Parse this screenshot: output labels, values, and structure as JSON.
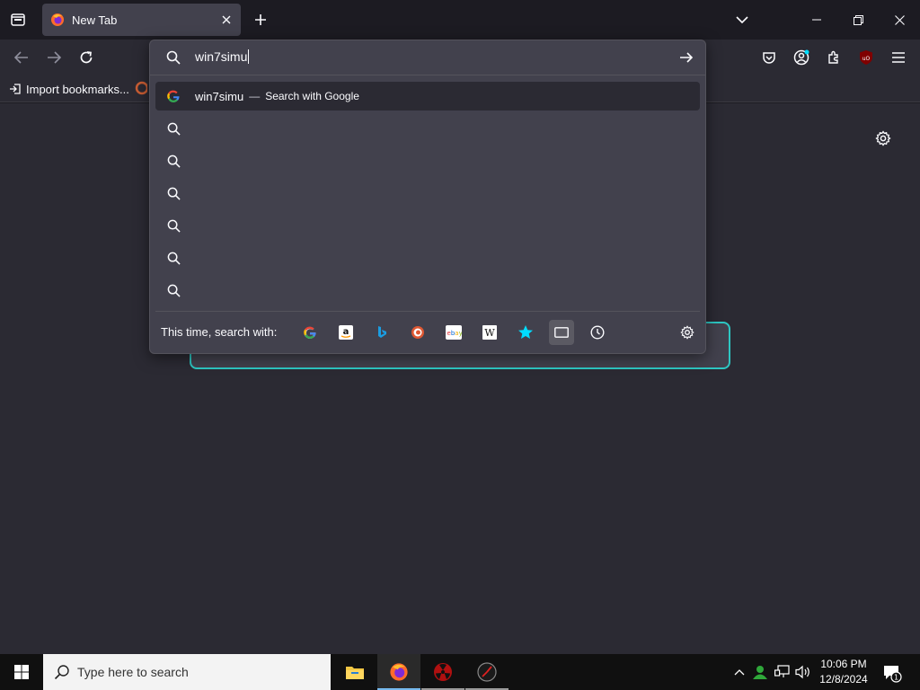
{
  "browser": {
    "tab_title": "New Tab",
    "bookmarks_import_label": "Import bookmarks..."
  },
  "urlbar": {
    "value": "win7simu",
    "suggestions": [
      {
        "text": "win7simu",
        "sub": "Search with Google",
        "icon": "google-icon",
        "selected": true
      },
      {
        "text": "",
        "icon": "search-icon"
      },
      {
        "text": "",
        "icon": "search-icon"
      },
      {
        "text": "",
        "icon": "search-icon"
      },
      {
        "text": "",
        "icon": "search-icon"
      },
      {
        "text": "",
        "icon": "search-icon"
      },
      {
        "text": "",
        "icon": "search-icon"
      }
    ],
    "dash": "—",
    "oneoff_label": "This time, search with:",
    "engines": [
      "google",
      "amazon",
      "bing",
      "duckduckgo",
      "ebay",
      "wikipedia",
      "bookmarks",
      "tabs",
      "history"
    ]
  },
  "taskbar": {
    "search_placeholder": "Type here to search",
    "time": "10:06 PM",
    "date": "12/8/2024",
    "notification_count": "1"
  },
  "colors": {
    "accent": "#2dc6c2",
    "panel": "#42414d",
    "toolbar": "#2b2a33"
  }
}
